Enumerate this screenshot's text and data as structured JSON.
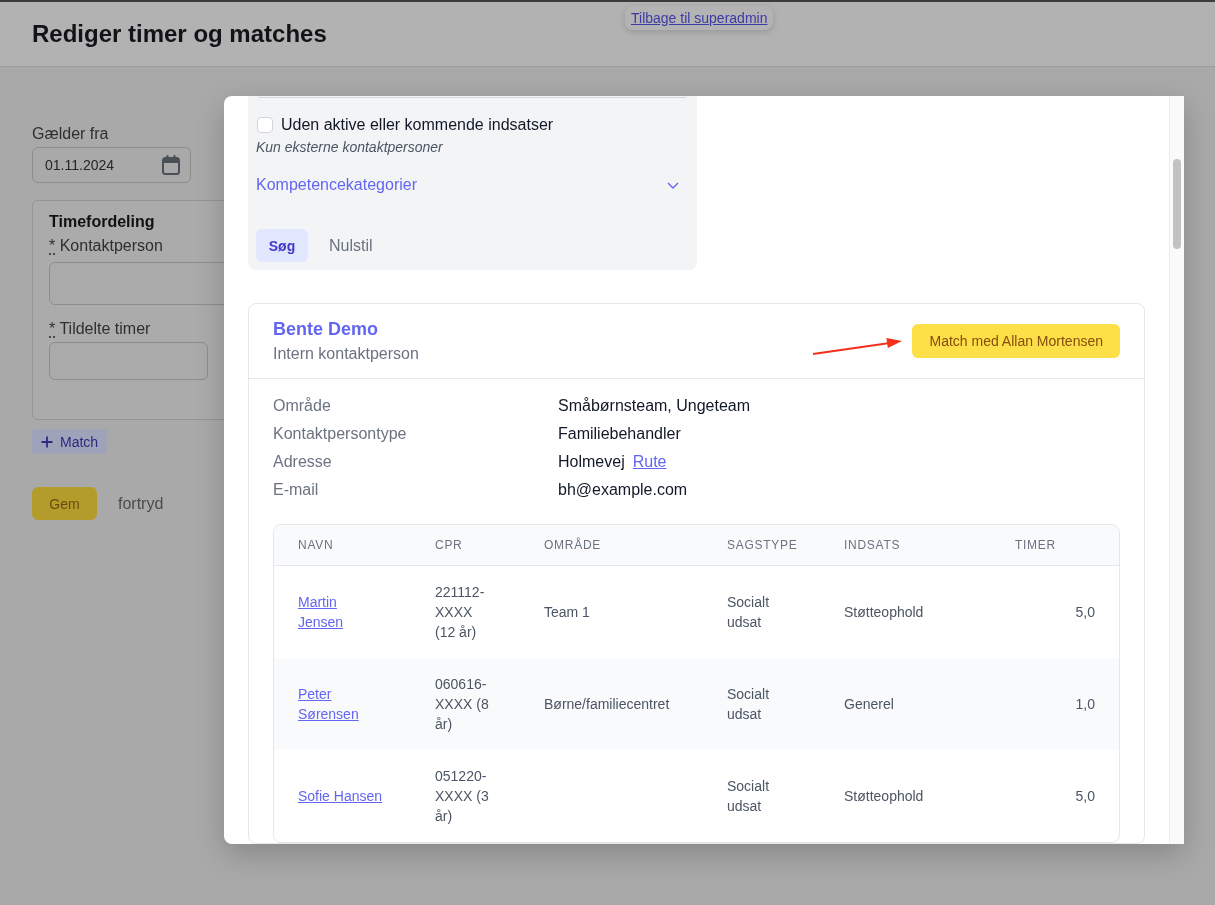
{
  "header": {
    "title": "Rediger timer og matches",
    "back_link": "Tilbage til superadmin"
  },
  "form": {
    "valid_from": {
      "label": "Gælder fra",
      "value": "01.11.2024"
    },
    "allocation": {
      "title": "Timefordeling",
      "fields": [
        {
          "label": "Kontaktperson",
          "required_mark": "*",
          "kind": "select"
        },
        {
          "label": "Tildelte timer",
          "required_mark": "*",
          "kind": "number"
        }
      ]
    },
    "add_match_button": "Match",
    "save_button": "Gem",
    "cancel_link": "fortryd"
  },
  "modal": {
    "filters": {
      "checkbox": {
        "label": "Uden aktive eller kommende indsatser",
        "checked": false
      },
      "note": "Kun eksterne kontaktpersoner",
      "accordion": {
        "label": "Kompetencekategorier",
        "expanded": false
      },
      "buttons": [
        {
          "label": "Søg",
          "kind": "primary"
        },
        {
          "label": "Nulstil",
          "kind": "plain"
        }
      ]
    },
    "contact": {
      "name": "Bente Demo",
      "role": "Intern kontaktperson",
      "match_button": "Match med Allan Mortensen",
      "details": [
        {
          "label": "Område",
          "value": "Småbørnsteam, Ungeteam"
        },
        {
          "label": "Kontaktpersontype",
          "value": "Familiebehandler"
        },
        {
          "label": "Adresse",
          "value": "Holmevej",
          "link": "Rute"
        },
        {
          "label": "E-mail",
          "value": "bh@example.com"
        }
      ],
      "table": {
        "columns": [
          "NAVN",
          "CPR",
          "OMRÅDE",
          "SAGSTYPE",
          "INDSATS",
          "TIMER"
        ],
        "rows": [
          {
            "name": "Martin Jensen",
            "cpr": "221112-XXXX (12 år)",
            "area": "Team 1",
            "case_type": "Socialt udsat",
            "intervention": "Støtteophold",
            "hours": "5,0"
          },
          {
            "name": "Peter Sørensen",
            "cpr": "060616-XXXX (8 år)",
            "area": "Børne/familiecentret",
            "case_type": "Socialt udsat",
            "intervention": "Generel",
            "hours": "1,0"
          },
          {
            "name": "Sofie Hansen",
            "cpr": "051220-XXXX (3 år)",
            "case_type": "Socialt udsat",
            "intervention": "Støtteophold",
            "hours": "5,0"
          }
        ]
      }
    }
  }
}
